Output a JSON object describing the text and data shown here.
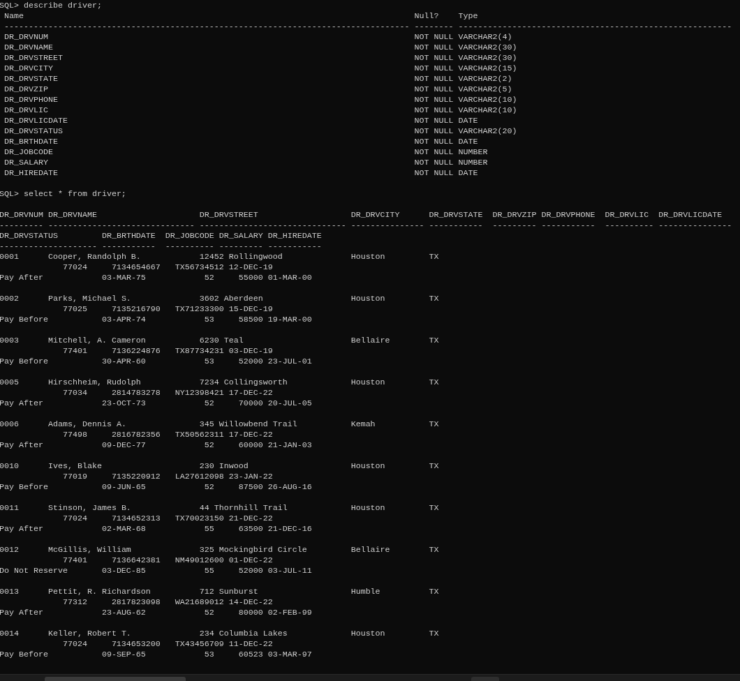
{
  "describe": {
    "command": "SQL> describe driver;",
    "headers": {
      "name": "Name",
      "null": "Null?",
      "type": "Type"
    },
    "rules": {
      "name": "-----------------------------------------------------------------------------------",
      "null": "--------",
      "type": "--------------------------------------------------------"
    },
    "columns": [
      {
        "name": "DR_DRVNUM",
        "null": "NOT NULL",
        "type": "VARCHAR2(4)"
      },
      {
        "name": "DR_DRVNAME",
        "null": "NOT NULL",
        "type": "VARCHAR2(30)"
      },
      {
        "name": "DR_DRVSTREET",
        "null": "NOT NULL",
        "type": "VARCHAR2(30)"
      },
      {
        "name": "DR_DRVCITY",
        "null": "NOT NULL",
        "type": "VARCHAR2(15)"
      },
      {
        "name": "DR_DRVSTATE",
        "null": "NOT NULL",
        "type": "VARCHAR2(2)"
      },
      {
        "name": "DR_DRVZIP",
        "null": "NOT NULL",
        "type": "VARCHAR2(5)"
      },
      {
        "name": "DR_DRVPHONE",
        "null": "NOT NULL",
        "type": "VARCHAR2(10)"
      },
      {
        "name": "DR_DRVLIC",
        "null": "NOT NULL",
        "type": "VARCHAR2(10)"
      },
      {
        "name": "DR_DRVLICDATE",
        "null": "NOT NULL",
        "type": "DATE"
      },
      {
        "name": "DR_DRVSTATUS",
        "null": "NOT NULL",
        "type": "VARCHAR2(20)"
      },
      {
        "name": "DR_BRTHDATE",
        "null": "NOT NULL",
        "type": "DATE"
      },
      {
        "name": "DR_JOBCODE",
        "null": "NOT NULL",
        "type": "NUMBER"
      },
      {
        "name": "DR_SALARY",
        "null": "NOT NULL",
        "type": "NUMBER"
      },
      {
        "name": "DR_HIREDATE",
        "null": "NOT NULL",
        "type": "DATE"
      }
    ]
  },
  "query": {
    "command": "SQL> select * from driver;",
    "header_lines": [
      [
        {
          "label": "DR_DRVNUM",
          "rule": "---------"
        },
        {
          "label": "DR_DRVNAME",
          "rule": "------------------------------"
        },
        {
          "label": "DR_DRVSTREET",
          "rule": "------------------------------"
        },
        {
          "label": "DR_DRVCITY",
          "rule": "---------------"
        },
        {
          "label": "DR_DRVSTATE",
          "rule": "-----------"
        },
        {
          "label": "DR_DRVZIP",
          "rule": "---------"
        },
        {
          "label": "DR_DRVPHONE",
          "rule": "-----------"
        },
        {
          "label": "DR_DRVLIC",
          "rule": "----------"
        },
        {
          "label": "DR_DRVLICDATE",
          "rule": "---------------"
        }
      ],
      [
        {
          "label": "DR_DRVSTATUS",
          "rule": "--------------------"
        },
        {
          "label": "DR_BRTHDATE",
          "rule": "-----------"
        },
        {
          "label": "DR_JOBCODE",
          "rule": "----------"
        },
        {
          "label": "DR_SALARY",
          "rule": "---------"
        },
        {
          "label": "DR_HIREDATE",
          "rule": "-----------"
        }
      ]
    ],
    "rows": [
      {
        "num": "0001",
        "name": "Cooper, Randolph B.",
        "street": "12452 Rollingwood",
        "city": "Houston",
        "state": "TX",
        "zip": "77024",
        "phone": "7134654667",
        "lic": "TX56734512",
        "licdate": "12-DEC-19",
        "status": "Pay After",
        "brthdate": "03-MAR-75",
        "jobcode": "52",
        "salary": "55000",
        "hiredate": "01-MAR-00"
      },
      {
        "num": "0002",
        "name": "Parks, Michael S.",
        "street": "3602 Aberdeen",
        "city": "Houston",
        "state": "TX",
        "zip": "77025",
        "phone": "7135216790",
        "lic": "TX71233300",
        "licdate": "15-DEC-19",
        "status": "Pay Before",
        "brthdate": "03-APR-74",
        "jobcode": "53",
        "salary": "58500",
        "hiredate": "19-MAR-00"
      },
      {
        "num": "0003",
        "name": "Mitchell, A. Cameron",
        "street": "6230 Teal",
        "city": "Bellaire",
        "state": "TX",
        "zip": "77401",
        "phone": "7136224876",
        "lic": "TX87734231",
        "licdate": "03-DEC-19",
        "status": "Pay Before",
        "brthdate": "30-APR-60",
        "jobcode": "53",
        "salary": "52000",
        "hiredate": "23-JUL-01"
      },
      {
        "num": "0005",
        "name": "Hirschheim, Rudolph",
        "street": "7234 Collingsworth",
        "city": "Houston",
        "state": "TX",
        "zip": "77034",
        "phone": "2814783278",
        "lic": "NY12398421",
        "licdate": "17-DEC-22",
        "status": "Pay After",
        "brthdate": "23-OCT-73",
        "jobcode": "52",
        "salary": "70000",
        "hiredate": "20-JUL-05"
      },
      {
        "num": "0006",
        "name": "Adams, Dennis A.",
        "street": "345 Willowbend Trail",
        "city": "Kemah",
        "state": "TX",
        "zip": "77498",
        "phone": "2816782356",
        "lic": "TX50562311",
        "licdate": "17-DEC-22",
        "status": "Pay After",
        "brthdate": "09-DEC-77",
        "jobcode": "52",
        "salary": "60000",
        "hiredate": "21-JAN-03"
      },
      {
        "num": "0010",
        "name": "Ives, Blake",
        "street": "230 Inwood",
        "city": "Houston",
        "state": "TX",
        "zip": "77019",
        "phone": "7135220912",
        "lic": "LA27612098",
        "licdate": "23-JAN-22",
        "status": "Pay Before",
        "brthdate": "09-JUN-65",
        "jobcode": "52",
        "salary": "87500",
        "hiredate": "26-AUG-16"
      },
      {
        "num": "0011",
        "name": "Stinson, James B.",
        "street": "44 Thornhill Trail",
        "city": "Houston",
        "state": "TX",
        "zip": "77024",
        "phone": "7134652313",
        "lic": "TX70023150",
        "licdate": "21-DEC-22",
        "status": "Pay After",
        "brthdate": "02-MAR-68",
        "jobcode": "55",
        "salary": "63500",
        "hiredate": "21-DEC-16"
      },
      {
        "num": "0012",
        "name": "McGillis, William",
        "street": "325 Mockingbird Circle",
        "city": "Bellaire",
        "state": "TX",
        "zip": "77401",
        "phone": "7136642381",
        "lic": "NM49012600",
        "licdate": "01-DEC-22",
        "status": "Do Not Reserve",
        "brthdate": "03-DEC-85",
        "jobcode": "55",
        "salary": "52000",
        "hiredate": "03-JUL-11"
      },
      {
        "num": "0013",
        "name": "Pettit, R. Richardson",
        "street": "712 Sunburst",
        "city": "Humble",
        "state": "TX",
        "zip": "77312",
        "phone": "2817823098",
        "lic": "WA21689012",
        "licdate": "14-DEC-22",
        "status": "Pay After",
        "brthdate": "23-AUG-62",
        "jobcode": "52",
        "salary": "80000",
        "hiredate": "02-FEB-99"
      },
      {
        "num": "0014",
        "name": "Keller, Robert T.",
        "street": "234 Columbia Lakes",
        "city": "Houston",
        "state": "TX",
        "zip": "77024",
        "phone": "7134653200",
        "lic": "TX43456709",
        "licdate": "11-DEC-22",
        "status": "Pay Before",
        "brthdate": "09-SEP-65",
        "jobcode": "53",
        "salary": "60523",
        "hiredate": "03-MAR-97"
      }
    ]
  }
}
